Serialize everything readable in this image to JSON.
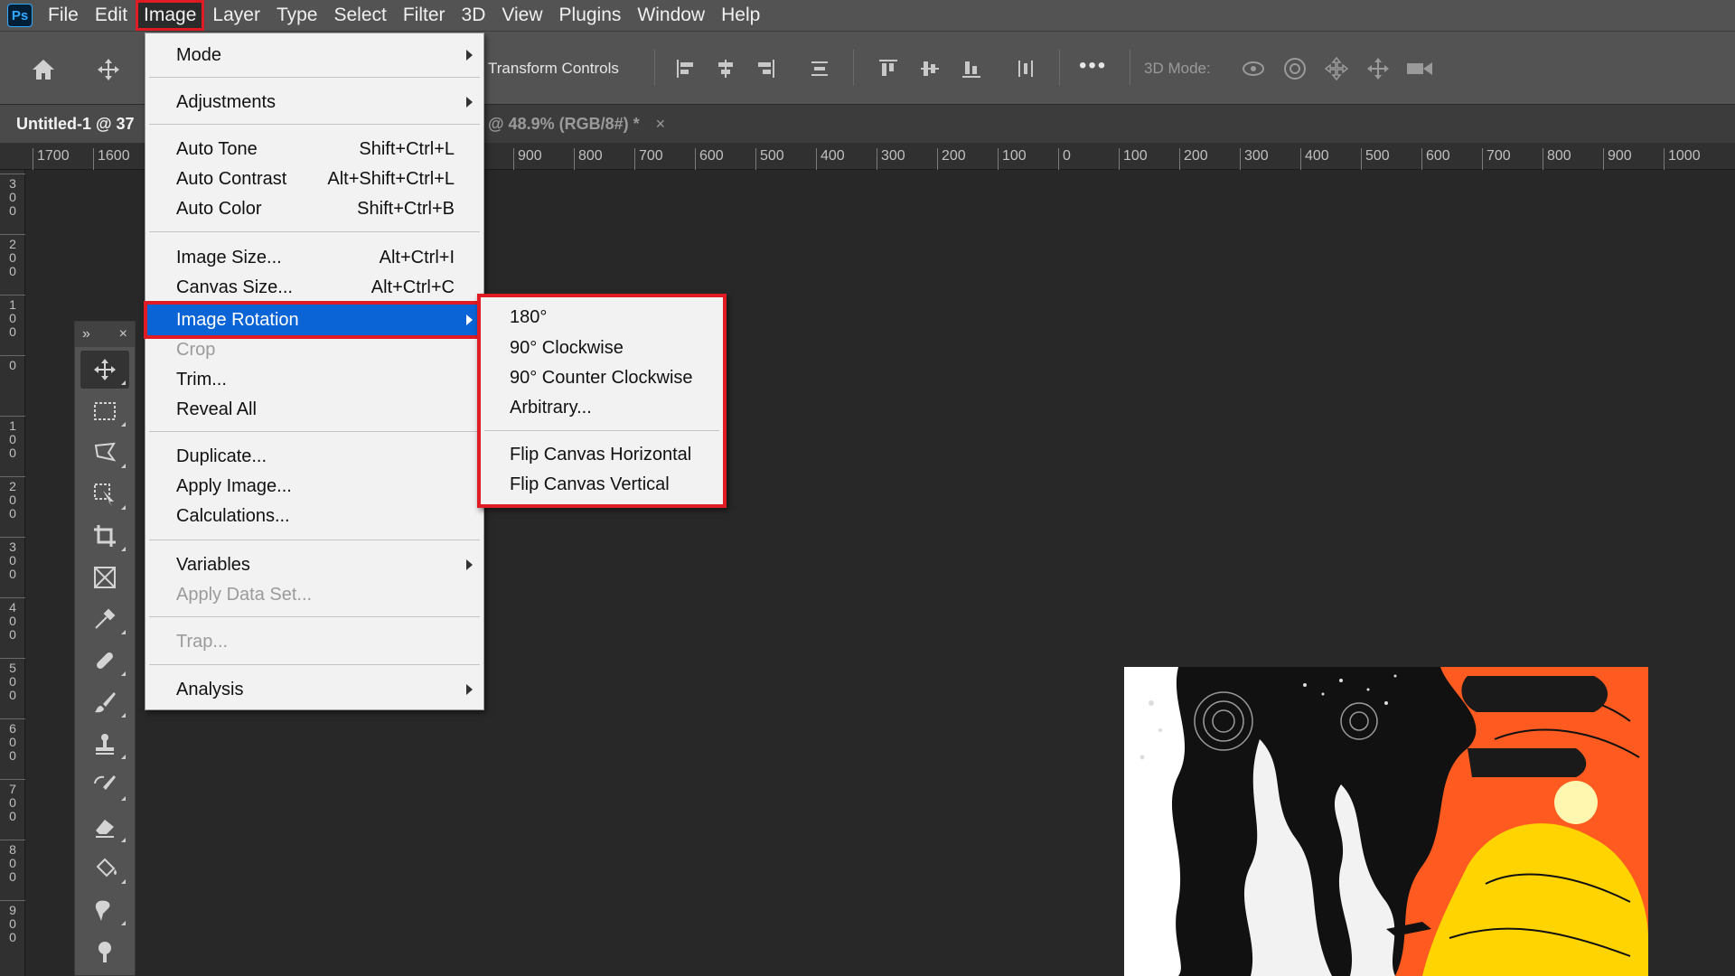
{
  "app": {
    "logo": "Ps"
  },
  "menubar": {
    "items": [
      "File",
      "Edit",
      "Image",
      "Layer",
      "Type",
      "Select",
      "Filter",
      "3D",
      "View",
      "Plugins",
      "Window",
      "Help"
    ],
    "active": "Image"
  },
  "options": {
    "transform_controls": "Transform Controls",
    "three_d_mode": "3D Mode:",
    "more": "•••"
  },
  "document": {
    "tab_title": "Untitled-1 @ 37",
    "tab_title_rest": "@ 48.9% (RGB/8#) *",
    "close": "×"
  },
  "rulers": {
    "top": [
      "1700",
      "1600",
      "900",
      "800",
      "700",
      "600",
      "500",
      "400",
      "300",
      "200",
      "100",
      "0",
      "100",
      "200",
      "300",
      "400",
      "500",
      "600",
      "700",
      "800",
      "900",
      "1000"
    ],
    "left": [
      [
        "3",
        "0",
        "0"
      ],
      [
        "2",
        "0",
        "0"
      ],
      [
        "1",
        "0",
        "0"
      ],
      [
        "0"
      ],
      [
        "1",
        "0",
        "0"
      ],
      [
        "2",
        "0",
        "0"
      ],
      [
        "3",
        "0",
        "0"
      ],
      [
        "4",
        "0",
        "0"
      ],
      [
        "5",
        "0",
        "0"
      ],
      [
        "6",
        "0",
        "0"
      ],
      [
        "7",
        "0",
        "0"
      ],
      [
        "8",
        "0",
        "0"
      ],
      [
        "9",
        "0",
        "0"
      ]
    ]
  },
  "tools_panel": {
    "expand": "»",
    "close": "×",
    "tools": [
      "move-tool-icon",
      "marquee-tool-icon",
      "lasso-tool-icon",
      "object-select-tool-icon",
      "crop-tool-icon",
      "frame-tool-icon",
      "eyedropper-tool-icon",
      "healing-brush-icon",
      "brush-tool-icon",
      "clone-stamp-icon",
      "history-brush-icon",
      "eraser-tool-icon",
      "paint-bucket-icon",
      "smudge-tool-icon",
      "dodge-tool-icon"
    ]
  },
  "image_menu": {
    "mode": "Mode",
    "adjustments": "Adjustments",
    "auto_tone": "Auto Tone",
    "auto_tone_sc": "Shift+Ctrl+L",
    "auto_contrast": "Auto Contrast",
    "auto_contrast_sc": "Alt+Shift+Ctrl+L",
    "auto_color": "Auto Color",
    "auto_color_sc": "Shift+Ctrl+B",
    "image_size": "Image Size...",
    "image_size_sc": "Alt+Ctrl+I",
    "canvas_size": "Canvas Size...",
    "canvas_size_sc": "Alt+Ctrl+C",
    "image_rotation": "Image Rotation",
    "crop": "Crop",
    "trim": "Trim...",
    "reveal_all": "Reveal All",
    "duplicate": "Duplicate...",
    "apply_image": "Apply Image...",
    "calculations": "Calculations...",
    "variables": "Variables",
    "apply_data_set": "Apply Data Set...",
    "trap": "Trap...",
    "analysis": "Analysis"
  },
  "rotation_submenu": {
    "r180": "180°",
    "cw90": "90° Clockwise",
    "ccw90": "90° Counter Clockwise",
    "arbitrary": "Arbitrary...",
    "flip_h": "Flip Canvas Horizontal",
    "flip_v": "Flip Canvas Vertical"
  },
  "colors": {
    "highlight": "#0a64d6",
    "annotation_red": "#e01b24",
    "art_orange": "#ff5a1f",
    "art_yellow": "#ffd400"
  }
}
